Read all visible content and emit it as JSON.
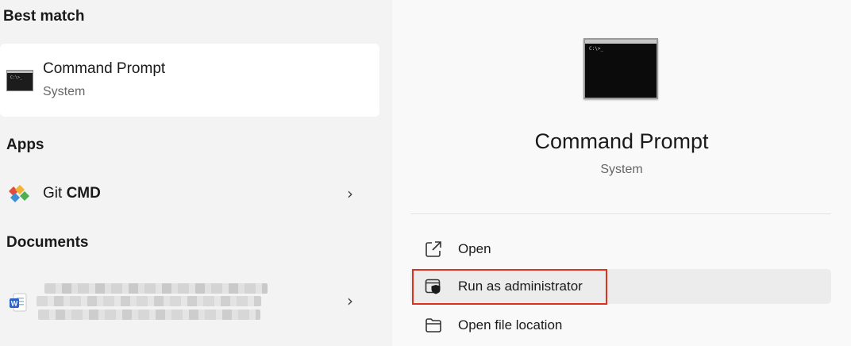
{
  "left_panel": {
    "best_match_title": "Best match",
    "best_match": {
      "title": "Command Prompt",
      "subtitle": "System",
      "icon": "cmd-terminal-icon"
    },
    "apps_title": "Apps",
    "apps": [
      {
        "title_prefix": "Git ",
        "title_bold": "CMD",
        "icon": "git-diamond-icon"
      }
    ],
    "documents_title": "Documents",
    "documents": [
      {
        "icon": "word-document-icon",
        "title": "",
        "subtitle": ""
      }
    ]
  },
  "right_panel": {
    "app_name": "Command Prompt",
    "app_type": "System",
    "actions": [
      {
        "label": "Open",
        "icon": "open-external-icon"
      },
      {
        "label": "Run as administrator",
        "icon": "shield-admin-icon",
        "highlighted": true
      },
      {
        "label": "Open file location",
        "icon": "folder-icon"
      }
    ]
  },
  "colors": {
    "highlight_border": "#e0301e",
    "card_bg": "#ffffff",
    "hover_bg": "#ececec"
  }
}
